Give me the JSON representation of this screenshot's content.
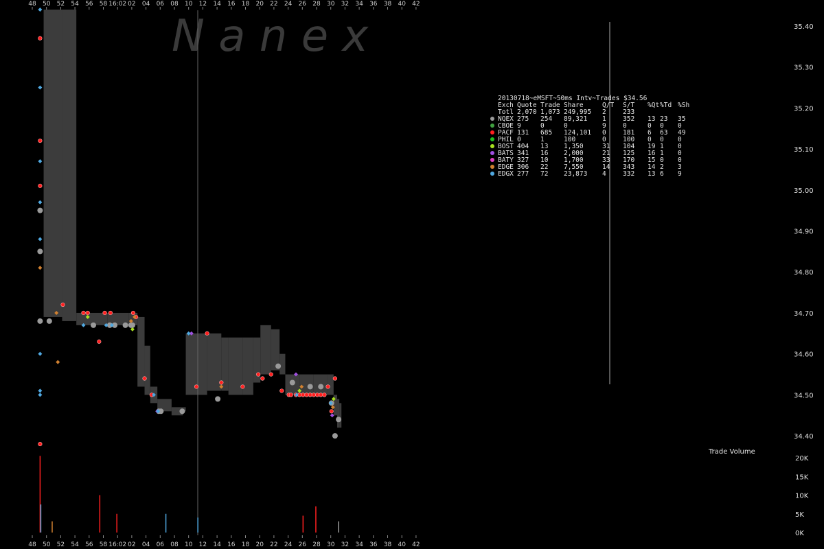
{
  "watermark": "N   a   n   e   x",
  "table": {
    "title": "20130718~eMSFT~50ms Intv~Trades $34.56",
    "header": [
      "Exch",
      "Quote",
      "Trade",
      "Share",
      "Q/T",
      "S/T",
      "%Qt",
      "%Td",
      "%Sh"
    ],
    "rows": [
      {
        "exch": "Totl",
        "color": "",
        "quote": "2,070",
        "trade": "1,073",
        "share": "249,995",
        "qt": "2",
        "st": "233",
        "pq": "",
        "pt": "",
        "ps": ""
      },
      {
        "exch": "NQEX",
        "color": "#9a9a9a",
        "quote": "275",
        "trade": "254",
        "share": "89,321",
        "qt": "1",
        "st": "352",
        "pq": "13",
        "pt": "23",
        "ps": "35"
      },
      {
        "exch": "CBOE",
        "color": "#40a040",
        "quote": "9",
        "trade": "0",
        "share": "0",
        "qt": "9",
        "st": "0",
        "pq": "0",
        "pt": "0",
        "ps": "0"
      },
      {
        "exch": "PACF",
        "color": "#ff2020",
        "quote": "131",
        "trade": "685",
        "share": "124,101",
        "qt": "0",
        "st": "181",
        "pq": "6",
        "pt": "63",
        "ps": "49"
      },
      {
        "exch": "PHIL",
        "color": "#20c020",
        "quote": "0",
        "trade": "1",
        "share": "100",
        "qt": "0",
        "st": "100",
        "pq": "0",
        "pt": "0",
        "ps": "0"
      },
      {
        "exch": "BOST",
        "color": "#a8e020",
        "quote": "404",
        "trade": "13",
        "share": "1,350",
        "qt": "31",
        "st": "104",
        "pq": "19",
        "pt": "1",
        "ps": "0"
      },
      {
        "exch": "BATS",
        "color": "#a050e0",
        "quote": "341",
        "trade": "16",
        "share": "2,000",
        "qt": "21",
        "st": "125",
        "pq": "16",
        "pt": "1",
        "ps": "0"
      },
      {
        "exch": "BATY",
        "color": "#e040c0",
        "quote": "327",
        "trade": "10",
        "share": "1,700",
        "qt": "33",
        "st": "170",
        "pq": "15",
        "pt": "0",
        "ps": "0"
      },
      {
        "exch": "EDGE",
        "color": "#d08030",
        "quote": "306",
        "trade": "22",
        "share": "7,550",
        "qt": "14",
        "st": "343",
        "pq": "14",
        "pt": "2",
        "ps": "3"
      },
      {
        "exch": "EDGX",
        "color": "#50a8e0",
        "quote": "277",
        "trade": "72",
        "share": "23,873",
        "qt": "4",
        "st": "332",
        "pq": "13",
        "pt": "6",
        "ps": "9"
      }
    ]
  },
  "chart_data": {
    "type": "scatter",
    "x_ticks": [
      "48",
      "50",
      "52",
      "54",
      "56",
      "58",
      "16:02",
      "02",
      "04",
      "06",
      "08",
      "10",
      "12",
      "14",
      "16",
      "18",
      "20",
      "22",
      "24",
      "26",
      "28",
      "30",
      "32",
      "34",
      "36",
      "38",
      "40",
      "42"
    ],
    "price_ticks": [
      "35.40",
      "35.30",
      "35.20",
      "35.10",
      "35.00",
      "34.90",
      "34.80",
      "34.70",
      "34.60",
      "34.50",
      "34.40"
    ],
    "price_ylim": [
      34.35,
      35.45
    ],
    "volume_title": "Trade Volume",
    "volume_ticks": [
      "20K",
      "15K",
      "10K",
      "5K",
      "0K"
    ],
    "volume_ylim": [
      0,
      20000
    ],
    "nbbo_band": [
      {
        "x": 0.0,
        "low": 34.69,
        "high": 35.44
      },
      {
        "x": 2.6,
        "low": 34.68,
        "high": 35.44
      },
      {
        "x": 4.6,
        "low": 34.67,
        "high": 34.7
      },
      {
        "x": 7.0,
        "low": 34.67,
        "high": 34.7
      },
      {
        "x": 9.0,
        "low": 34.67,
        "high": 34.7
      },
      {
        "x": 12.0,
        "low": 34.67,
        "high": 34.7
      },
      {
        "x": 12.8,
        "low": 34.67,
        "high": 34.7
      },
      {
        "x": 13.2,
        "low": 34.52,
        "high": 34.69
      },
      {
        "x": 14.2,
        "low": 34.5,
        "high": 34.62
      },
      {
        "x": 15.0,
        "low": 34.48,
        "high": 34.52
      },
      {
        "x": 16.0,
        "low": 34.46,
        "high": 34.49
      },
      {
        "x": 17.0,
        "low": 34.46,
        "high": 34.49
      },
      {
        "x": 18.0,
        "low": 34.45,
        "high": 34.47
      },
      {
        "x": 19.6,
        "low": 34.46,
        "high": 34.47
      },
      {
        "x": 20.0,
        "low": 34.5,
        "high": 34.65
      },
      {
        "x": 23.0,
        "low": 34.51,
        "high": 34.65
      },
      {
        "x": 25.0,
        "low": 34.51,
        "high": 34.64
      },
      {
        "x": 26.0,
        "low": 34.5,
        "high": 34.64
      },
      {
        "x": 28.0,
        "low": 34.5,
        "high": 34.64
      },
      {
        "x": 29.5,
        "low": 34.53,
        "high": 34.64
      },
      {
        "x": 30.5,
        "low": 34.55,
        "high": 34.67
      },
      {
        "x": 32.0,
        "low": 34.56,
        "high": 34.66
      },
      {
        "x": 33.2,
        "low": 34.55,
        "high": 34.6
      },
      {
        "x": 34.0,
        "low": 34.5,
        "high": 34.55
      },
      {
        "x": 36.0,
        "low": 34.5,
        "high": 34.55
      },
      {
        "x": 38.0,
        "low": 34.5,
        "high": 34.55
      },
      {
        "x": 40.0,
        "low": 34.5,
        "high": 34.55
      },
      {
        "x": 40.8,
        "low": 34.45,
        "high": 34.5
      },
      {
        "x": 41.3,
        "low": 34.42,
        "high": 34.49
      },
      {
        "x": 41.6,
        "low": 34.42,
        "high": 34.48
      }
    ],
    "series": [
      {
        "name": "NQEX",
        "color": "#9a9a9a",
        "points": [
          [
            -0.5,
            34.68
          ],
          [
            0.8,
            34.68
          ],
          [
            -0.5,
            34.95
          ],
          [
            -0.5,
            34.85
          ],
          [
            7.0,
            34.67
          ],
          [
            9.3,
            34.67
          ],
          [
            10.0,
            34.67
          ],
          [
            11.5,
            34.67
          ],
          [
            12.3,
            34.67
          ],
          [
            12.5,
            34.67
          ],
          [
            16.5,
            34.46
          ],
          [
            19.5,
            34.46
          ],
          [
            24.5,
            34.49
          ],
          [
            33.0,
            34.57
          ],
          [
            35.0,
            34.53
          ],
          [
            37.5,
            34.52
          ],
          [
            39.0,
            34.52
          ],
          [
            40.5,
            34.48
          ],
          [
            41.0,
            34.4
          ],
          [
            41.5,
            34.44
          ],
          [
            16.2,
            34.46
          ]
        ]
      },
      {
        "name": "PACF",
        "color": "#ff2020",
        "points": [
          [
            7.8,
            34.63
          ],
          [
            -0.5,
            35.37
          ],
          [
            -0.5,
            35.12
          ],
          [
            -0.5,
            35.01
          ],
          [
            -0.5,
            34.38
          ],
          [
            2.7,
            34.72
          ],
          [
            5.6,
            34.7
          ],
          [
            6.2,
            34.7
          ],
          [
            8.6,
            34.7
          ],
          [
            9.4,
            34.7
          ],
          [
            12.6,
            34.7
          ],
          [
            13.0,
            34.69
          ],
          [
            14.2,
            34.54
          ],
          [
            15.2,
            34.5
          ],
          [
            21.5,
            34.52
          ],
          [
            23.0,
            34.65
          ],
          [
            25.0,
            34.53
          ],
          [
            28.0,
            34.52
          ],
          [
            30.2,
            34.55
          ],
          [
            30.8,
            34.54
          ],
          [
            32.0,
            34.55
          ],
          [
            33.5,
            34.51
          ],
          [
            34.5,
            34.5
          ],
          [
            35.5,
            34.5
          ],
          [
            36.5,
            34.5
          ],
          [
            37.5,
            34.5
          ],
          [
            38.5,
            34.5
          ],
          [
            39.5,
            34.5
          ],
          [
            40.0,
            34.52
          ],
          [
            40.5,
            34.46
          ],
          [
            41.0,
            34.54
          ],
          [
            34.8,
            34.5
          ],
          [
            36.0,
            34.5
          ],
          [
            37.0,
            34.5
          ],
          [
            38.0,
            34.5
          ],
          [
            39.0,
            34.5
          ]
        ]
      },
      {
        "name": "BOST",
        "color": "#a8e020",
        "points": [
          [
            6.2,
            34.69
          ],
          [
            12.5,
            34.66
          ],
          [
            36.0,
            34.51
          ],
          [
            40.8,
            34.49
          ]
        ]
      },
      {
        "name": "BATS",
        "color": "#a050e0",
        "points": [
          [
            20.8,
            34.65
          ],
          [
            35.5,
            34.55
          ],
          [
            16.0,
            34.46
          ],
          [
            40.6,
            34.45
          ]
        ]
      },
      {
        "name": "EDGE",
        "color": "#d08030",
        "points": [
          [
            -0.5,
            34.81
          ],
          [
            1.8,
            34.7
          ],
          [
            2.0,
            34.58
          ],
          [
            12.3,
            34.68
          ],
          [
            12.8,
            34.69
          ],
          [
            25.0,
            34.52
          ],
          [
            36.3,
            34.52
          ],
          [
            40.7,
            34.47
          ]
        ]
      },
      {
        "name": "EDGX",
        "color": "#50a8e0",
        "points": [
          [
            -0.5,
            35.44
          ],
          [
            -0.5,
            35.25
          ],
          [
            -0.5,
            35.07
          ],
          [
            -0.5,
            34.97
          ],
          [
            -0.5,
            34.88
          ],
          [
            -0.5,
            34.6
          ],
          [
            -0.5,
            34.51
          ],
          [
            -0.5,
            34.5
          ],
          [
            5.6,
            34.67
          ],
          [
            8.8,
            34.67
          ],
          [
            9.6,
            34.67
          ],
          [
            16.1,
            34.46
          ],
          [
            20.4,
            34.65
          ],
          [
            15.5,
            34.5
          ],
          [
            35.6,
            34.5
          ],
          [
            40.4,
            34.48
          ]
        ]
      }
    ],
    "volume": [
      {
        "x": -0.5,
        "v": 20500,
        "color": "#ff2020"
      },
      {
        "x": -0.4,
        "v": 7500,
        "color": "#50a8e0"
      },
      {
        "x": 1.2,
        "v": 3000,
        "color": "#d08030"
      },
      {
        "x": 7.9,
        "v": 10000,
        "color": "#ff2020"
      },
      {
        "x": 10.3,
        "v": 5000,
        "color": "#ff2020"
      },
      {
        "x": 17.2,
        "v": 5000,
        "color": "#50a8e0"
      },
      {
        "x": 21.7,
        "v": 4000,
        "color": "#50a8e0"
      },
      {
        "x": 38.3,
        "v": 7000,
        "color": "#ff2020"
      },
      {
        "x": 36.5,
        "v": 4500,
        "color": "#ff2020"
      },
      {
        "x": 41.5,
        "v": 3000,
        "color": "#9a9a9a"
      }
    ]
  }
}
